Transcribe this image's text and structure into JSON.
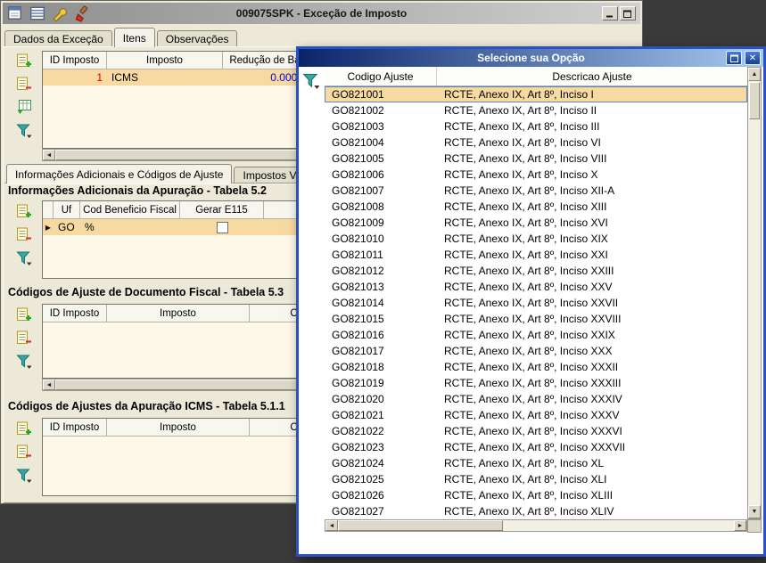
{
  "main_window": {
    "title": "009075SPK - Exceção de Imposto",
    "tabs": [
      {
        "label": "Dados da Exceção",
        "active": false
      },
      {
        "label": "Itens",
        "active": true
      },
      {
        "label": "Observações",
        "active": false
      }
    ],
    "items_grid": {
      "columns": [
        "ID Imposto",
        "Imposto",
        "Redução de Ba"
      ],
      "rows": [
        {
          "id": "1",
          "imposto": "ICMS",
          "reducao": "0.0000"
        }
      ]
    },
    "section_tabs": [
      {
        "label": "Informações Adicionais e Códigos de Ajuste",
        "active": true
      },
      {
        "label": "Impostos Vinculad",
        "active": false
      }
    ],
    "section_adicionais": {
      "title": "Informações Adicionais da Apuração - Tabela 5.2",
      "columns": [
        "Uf",
        "Cod Beneficio Fiscal",
        "Gerar E115"
      ],
      "rows": [
        {
          "uf": "GO",
          "cod_beneficio": "%",
          "gerar_e115": false
        }
      ]
    },
    "section_ajuste_doc": {
      "title": "Códigos de Ajuste de Documento Fiscal - Tabela 5.3",
      "columns": [
        "ID Imposto",
        "Imposto",
        "C"
      ]
    },
    "section_ajuste_apuracao": {
      "title": "Códigos de Ajustes da Apuração ICMS - Tabela 5.1.1",
      "columns": [
        "ID Imposto",
        "Imposto",
        "C"
      ]
    }
  },
  "popup": {
    "title": "Selecione sua Opção",
    "close_glyph": "✕",
    "columns": [
      "Codigo Ajuste",
      "Descricao Ajuste"
    ],
    "selected_index": 0,
    "rows": [
      {
        "codigo": "GO821001",
        "descricao": "RCTE, Anexo IX, Art 8º, Inciso I"
      },
      {
        "codigo": "GO821002",
        "descricao": "RCTE, Anexo IX, Art 8º, Inciso II"
      },
      {
        "codigo": "GO821003",
        "descricao": "RCTE, Anexo IX, Art 8º, Inciso III"
      },
      {
        "codigo": "GO821004",
        "descricao": "RCTE, Anexo IX, Art 8º, Inciso VI"
      },
      {
        "codigo": "GO821005",
        "descricao": "RCTE, Anexo IX, Art 8º, Inciso VIII"
      },
      {
        "codigo": "GO821006",
        "descricao": "RCTE, Anexo IX, Art 8º, Inciso X"
      },
      {
        "codigo": "GO821007",
        "descricao": "RCTE, Anexo IX, Art 8º, Inciso XII-A"
      },
      {
        "codigo": "GO821008",
        "descricao": "RCTE, Anexo IX, Art 8º, Inciso XIII"
      },
      {
        "codigo": "GO821009",
        "descricao": "RCTE, Anexo IX, Art 8º, Inciso XVI"
      },
      {
        "codigo": "GO821010",
        "descricao": "RCTE, Anexo IX, Art 8º, Inciso XIX"
      },
      {
        "codigo": "GO821011",
        "descricao": "RCTE, Anexo IX, Art 8º, Inciso XXI"
      },
      {
        "codigo": "GO821012",
        "descricao": "RCTE, Anexo IX, Art 8º, Inciso XXIII"
      },
      {
        "codigo": "GO821013",
        "descricao": "RCTE, Anexo IX, Art 8º, Inciso XXV"
      },
      {
        "codigo": "GO821014",
        "descricao": "RCTE, Anexo IX, Art 8º, Inciso XXVII"
      },
      {
        "codigo": "GO821015",
        "descricao": "RCTE, Anexo IX, Art 8º, Inciso XXVIII"
      },
      {
        "codigo": "GO821016",
        "descricao": "RCTE, Anexo IX, Art 8º, Inciso XXIX"
      },
      {
        "codigo": "GO821017",
        "descricao": "RCTE, Anexo IX, Art 8º, Inciso XXX"
      },
      {
        "codigo": "GO821018",
        "descricao": "RCTE, Anexo IX, Art 8º, Inciso XXXII"
      },
      {
        "codigo": "GO821019",
        "descricao": "RCTE, Anexo IX, Art 8º, Inciso XXXIII"
      },
      {
        "codigo": "GO821020",
        "descricao": "RCTE, Anexo IX, Art 8º, Inciso XXXIV"
      },
      {
        "codigo": "GO821021",
        "descricao": "RCTE, Anexo IX, Art 8º, Inciso XXXV"
      },
      {
        "codigo": "GO821022",
        "descricao": "RCTE, Anexo IX, Art 8º, Inciso XXXVI"
      },
      {
        "codigo": "GO821023",
        "descricao": "RCTE, Anexo IX, Art 8º, Inciso XXXVII"
      },
      {
        "codigo": "GO821024",
        "descricao": "RCTE, Anexo IX, Art 8º, Inciso XL"
      },
      {
        "codigo": "GO821025",
        "descricao": "RCTE, Anexo IX, Art 8º, Inciso XLI"
      },
      {
        "codigo": "GO821026",
        "descricao": "RCTE, Anexo IX, Art 8º, Inciso XLIII"
      },
      {
        "codigo": "GO821027",
        "descricao": "RCTE, Anexo IX, Art 8º, Inciso XLIV"
      }
    ]
  },
  "icons": {
    "titlebar": [
      "report-icon",
      "grid-icon",
      "wrench-icon",
      "brush-icon"
    ],
    "navigator": [
      "insert-record-icon",
      "delete-record-icon",
      "post-record-icon",
      "filter-icon"
    ],
    "popup": [
      "filter-icon",
      "maximize-icon",
      "close-icon"
    ]
  },
  "colors": {
    "selection": "#f7d9a2",
    "grid_bg": "#fdf8e7",
    "value_red": "#d40000",
    "value_blue": "#0000d4",
    "popup_title_from": "#0a246a",
    "popup_title_to": "#a6caf0",
    "popup_border": "#2a52be"
  }
}
